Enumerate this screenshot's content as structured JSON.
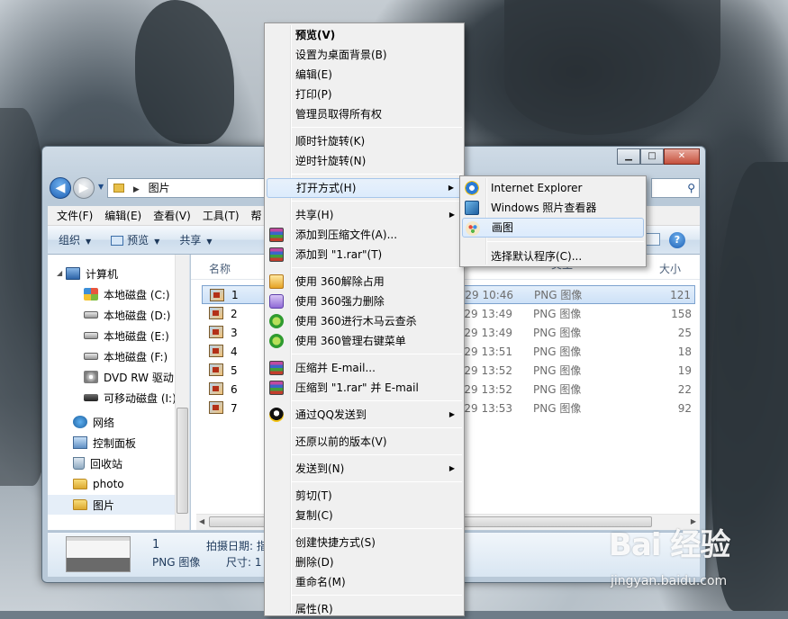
{
  "window": {
    "address_segments": [
      "图片"
    ]
  },
  "menubar": [
    "文件(F)",
    "编辑(E)",
    "查看(V)",
    "工具(T)",
    "帮"
  ],
  "toolbar": {
    "organize": "组织",
    "preview": "预览",
    "share": "共享"
  },
  "nav_pane": [
    {
      "label": "计算机",
      "icon": "computer-icon"
    },
    {
      "label": "本地磁盘 (C:)",
      "icon": "windows-drive-icon"
    },
    {
      "label": "本地磁盘 (D:)",
      "icon": "drive-icon"
    },
    {
      "label": "本地磁盘 (E:)",
      "icon": "drive-icon"
    },
    {
      "label": "本地磁盘 (F:)",
      "icon": "drive-icon"
    },
    {
      "label": "DVD RW 驱动",
      "icon": "dvd-icon"
    },
    {
      "label": "可移动磁盘 (I:)",
      "icon": "usb-icon"
    },
    {
      "label": "网络",
      "icon": "network-icon"
    },
    {
      "label": "控制面板",
      "icon": "control-panel-icon"
    },
    {
      "label": "回收站",
      "icon": "recycle-bin-icon"
    },
    {
      "label": "photo",
      "icon": "folder-icon"
    },
    {
      "label": "图片",
      "icon": "folder-icon",
      "selected": true
    }
  ],
  "file_pane": {
    "columns": {
      "name": "名称",
      "type": "类型",
      "size": "大小"
    },
    "rows": [
      {
        "name": "1",
        "date": "3/7/29 10:46",
        "type": "PNG 图像",
        "size": "121",
        "selected": true
      },
      {
        "name": "2",
        "date": "3/7/29 13:49",
        "type": "PNG 图像",
        "size": "158"
      },
      {
        "name": "3",
        "date": "3/7/29 13:49",
        "type": "PNG 图像",
        "size": "25"
      },
      {
        "name": "4",
        "date": "3/7/29 13:51",
        "type": "PNG 图像",
        "size": "18"
      },
      {
        "name": "5",
        "date": "3/7/29 13:52",
        "type": "PNG 图像",
        "size": "19"
      },
      {
        "name": "6",
        "date": "3/7/29 13:52",
        "type": "PNG 图像",
        "size": "22"
      },
      {
        "name": "7",
        "date": "3/7/29 13:53",
        "type": "PNG 图像",
        "size": "92"
      }
    ]
  },
  "details": {
    "name": "1",
    "type": "PNG 图像",
    "date_label": "拍摄日期: 指",
    "size_label": "尺寸: 1"
  },
  "context_menu": {
    "items": [
      {
        "label": "预览(V)",
        "bold": true
      },
      {
        "label": "设置为桌面背景(B)"
      },
      {
        "label": "编辑(E)"
      },
      {
        "label": "打印(P)"
      },
      {
        "label": "管理员取得所有权"
      },
      {
        "sep": true
      },
      {
        "label": "顺时针旋转(K)"
      },
      {
        "label": "逆时针旋转(N)"
      },
      {
        "sep": true
      },
      {
        "label": "打开方式(H)",
        "submenu": true,
        "hover": true
      },
      {
        "sep": true
      },
      {
        "label": "共享(H)",
        "submenu": true
      },
      {
        "label": "添加到压缩文件(A)...",
        "icon": "winrar-icon"
      },
      {
        "label": "添加到 \"1.rar\"(T)",
        "icon": "winrar-icon"
      },
      {
        "sep": true
      },
      {
        "label": "使用 360解除占用",
        "icon": "360-unlock-icon"
      },
      {
        "label": "使用 360强力删除",
        "icon": "360-shred-icon"
      },
      {
        "label": "使用 360进行木马云查杀",
        "icon": "360-scan-icon"
      },
      {
        "label": "使用 360管理右键菜单",
        "icon": "360-scan-icon"
      },
      {
        "sep": true
      },
      {
        "label": "压缩并 E-mail...",
        "icon": "winrar-icon"
      },
      {
        "label": "压缩到 \"1.rar\" 并 E-mail",
        "icon": "winrar-icon"
      },
      {
        "sep": true
      },
      {
        "label": "通过QQ发送到",
        "icon": "qq-icon",
        "submenu": true
      },
      {
        "sep": true
      },
      {
        "label": "还原以前的版本(V)"
      },
      {
        "sep": true
      },
      {
        "label": "发送到(N)",
        "submenu": true
      },
      {
        "sep": true
      },
      {
        "label": "剪切(T)"
      },
      {
        "label": "复制(C)"
      },
      {
        "sep": true
      },
      {
        "label": "创建快捷方式(S)"
      },
      {
        "label": "删除(D)"
      },
      {
        "label": "重命名(M)"
      },
      {
        "sep": true
      },
      {
        "label": "属性(R)"
      }
    ]
  },
  "open_with_menu": {
    "items": [
      {
        "label": "Internet Explorer",
        "icon": "internet-explorer-icon"
      },
      {
        "label": "Windows 照片查看器",
        "icon": "photo-viewer-icon"
      },
      {
        "label": "画图",
        "icon": "paint-icon",
        "hover": true
      },
      {
        "sep": true
      },
      {
        "label": "选择默认程序(C)..."
      }
    ]
  },
  "watermark": {
    "logo": "Bai 经验",
    "url": "jingyan.baidu.com"
  }
}
